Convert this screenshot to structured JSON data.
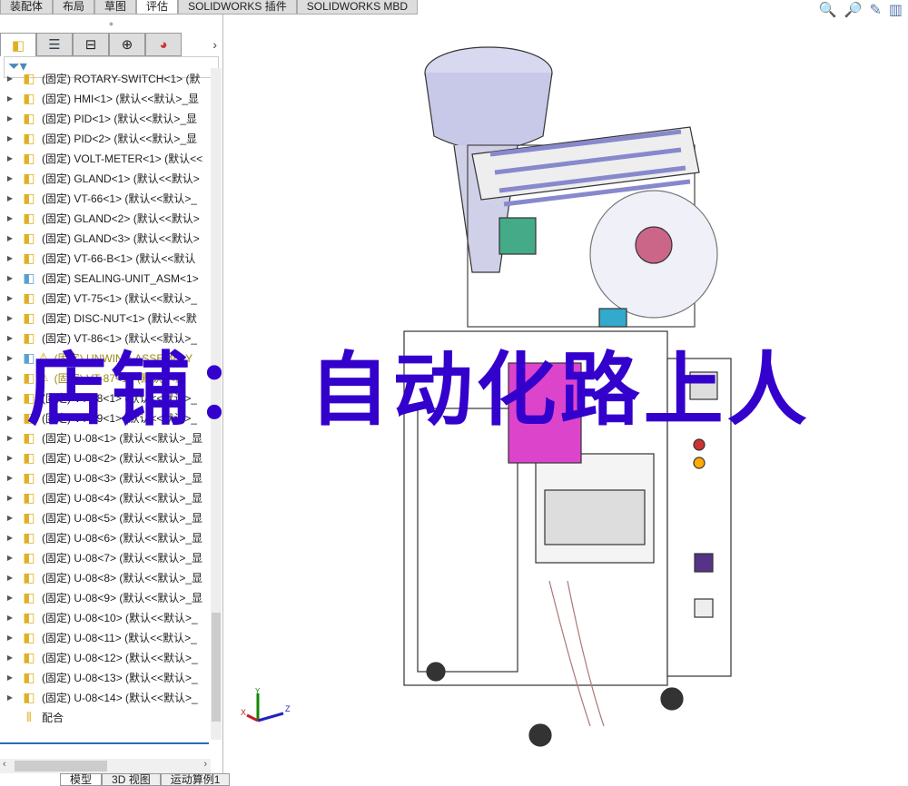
{
  "command_tabs": [
    "装配体",
    "布局",
    "草图",
    "评估",
    "SOLIDWORKS 插件",
    "SOLIDWORKS MBD"
  ],
  "active_tab": "评估",
  "view_icons": [
    "zoom-to-fit-icon",
    "zoom-to-area-icon",
    "previous-view-icon",
    "section-view-icon"
  ],
  "panel_tabs": [
    "feature-manager-icon",
    "property-manager-icon",
    "configuration-manager-icon",
    "dimxpert-icon",
    "display-manager-icon"
  ],
  "tree": [
    {
      "label": "(固定) ROTARY-SWITCH<1> (默"
    },
    {
      "label": "(固定) HMI<1> (默认<<默认>_显"
    },
    {
      "label": "(固定) PID<1> (默认<<默认>_显"
    },
    {
      "label": "(固定) PID<2> (默认<<默认>_显"
    },
    {
      "label": "(固定) VOLT-METER<1> (默认<<"
    },
    {
      "label": "(固定) GLAND<1> (默认<<默认>"
    },
    {
      "label": "(固定) VT-66<1> (默认<<默认>_"
    },
    {
      "label": "(固定) GLAND<2> (默认<<默认>"
    },
    {
      "label": "(固定) GLAND<3> (默认<<默认>"
    },
    {
      "label": "(固定) VT-66-B<1> (默认<<默认"
    },
    {
      "label": "(固定) SEALING-UNIT_ASM<1>",
      "asm": true
    },
    {
      "label": "(固定) VT-75<1> (默认<<默认>_"
    },
    {
      "label": "(固定) DISC-NUT<1> (默认<<默"
    },
    {
      "label": "(固定) VT-86<1> (默认<<默认>_"
    },
    {
      "label": "(固定) UNWIND-ASSEMBLY",
      "asm": true,
      "warning": true
    },
    {
      "label": "(固定) VT-87<1> (默认<<默",
      "warning": true
    },
    {
      "label": "(固定) VT-88<1> (默认<<默认>_"
    },
    {
      "label": "(固定) VT-89<1> (默认<<默认>_"
    },
    {
      "label": "(固定) U-08<1> (默认<<默认>_显"
    },
    {
      "label": "(固定) U-08<2> (默认<<默认>_显"
    },
    {
      "label": "(固定) U-08<3> (默认<<默认>_显"
    },
    {
      "label": "(固定) U-08<4> (默认<<默认>_显"
    },
    {
      "label": "(固定) U-08<5> (默认<<默认>_显"
    },
    {
      "label": "(固定) U-08<6> (默认<<默认>_显"
    },
    {
      "label": "(固定) U-08<7> (默认<<默认>_显"
    },
    {
      "label": "(固定) U-08<8> (默认<<默认>_显"
    },
    {
      "label": "(固定) U-08<9> (默认<<默认>_显"
    },
    {
      "label": "(固定) U-08<10> (默认<<默认>_"
    },
    {
      "label": "(固定) U-08<11> (默认<<默认>_"
    },
    {
      "label": "(固定) U-08<12> (默认<<默认>_"
    },
    {
      "label": "(固定) U-08<13> (默认<<默认>_"
    },
    {
      "label": "(固定) U-08<14> (默认<<默认>_"
    },
    {
      "label": "配合",
      "mates": true
    }
  ],
  "bottom_tabs": [
    "模型",
    "3D 视图",
    "运动算例1"
  ],
  "watermark": "店铺： 自动化路上人",
  "triad": {
    "x": "X",
    "y": "Y",
    "z": "Z"
  },
  "colors": {
    "watermark": "#3300cc",
    "warning_text": "#9a8a10",
    "part_icon": "#e0b020"
  }
}
